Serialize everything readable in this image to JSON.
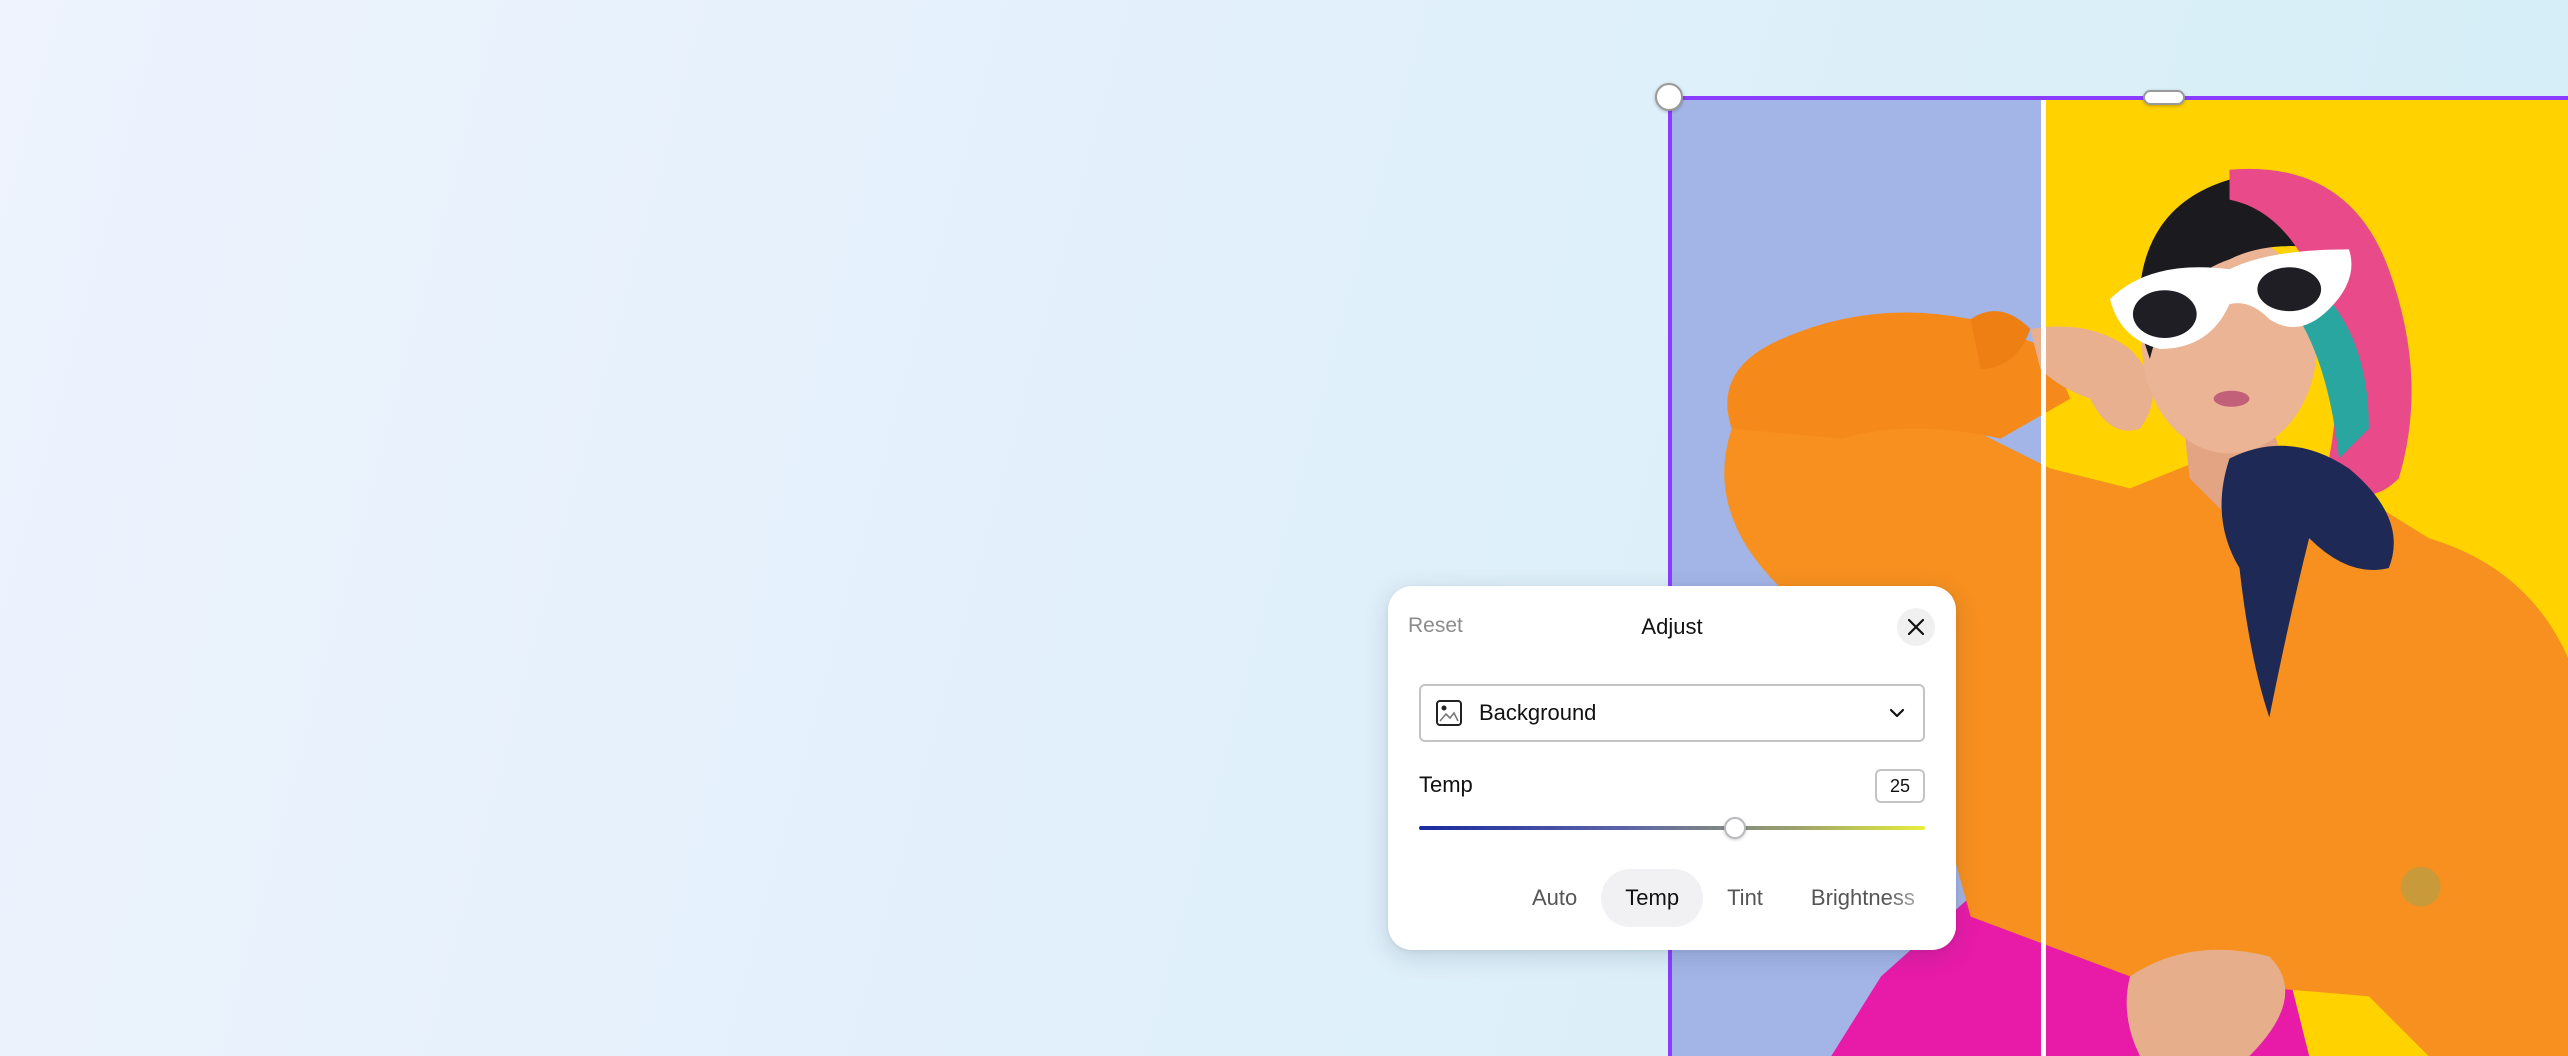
{
  "panel": {
    "reset_label": "Reset",
    "title": "Adjust",
    "close_icon": "close-icon",
    "dropdown": {
      "icon": "image-background-icon",
      "selected": "Background",
      "chevron_icon": "chevron-down-icon"
    },
    "slider": {
      "label": "Temp",
      "value": "25",
      "min": -100,
      "max": 100
    },
    "tabs": [
      {
        "label": "Auto",
        "active": false
      },
      {
        "label": "Temp",
        "active": true
      },
      {
        "label": "Tint",
        "active": false
      },
      {
        "label": "Brightness",
        "active": false
      }
    ]
  },
  "colors": {
    "selection_border": "#8b3dff",
    "left_background": "#a3b4e6",
    "right_background": "#ffd200"
  }
}
